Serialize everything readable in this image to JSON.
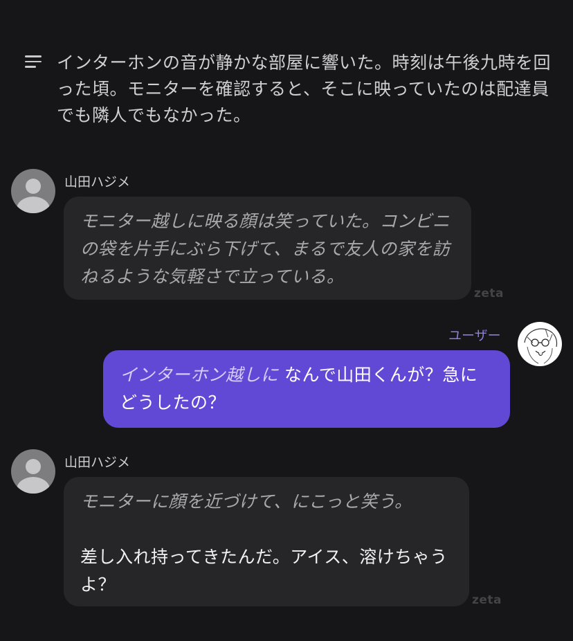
{
  "narration": {
    "text": "インターホンの音が静かな部屋に響いた。時刻は午後九時を回った頃。モニターを確認すると、そこに映っていたのは配達員でも隣人でもなかった。"
  },
  "messages": [
    {
      "sender": "山田ハジメ",
      "action": "モニター越しに映る顔は笑っていた。コンビニの袋を片手にぶら下げて、まるで友人の家を訪ねるような気軽さで立っている。",
      "watermark": "zeta"
    },
    {
      "sender": "ユーザー",
      "action": "インターホン越しに",
      "speech": "なんで山田くんが？急にどうしたの？"
    },
    {
      "sender": "山田ハジメ",
      "action": "モニターに顔を近づけて、にこっと笑う。",
      "speech": "差し入れ持ってきたんだ。アイス、溶けちゃうよ？",
      "watermark": "zeta"
    }
  ],
  "colors": {
    "background": "#161618",
    "bot_bubble": "#262629",
    "user_bubble": "#6149d6",
    "user_name": "#8c7ee0"
  }
}
